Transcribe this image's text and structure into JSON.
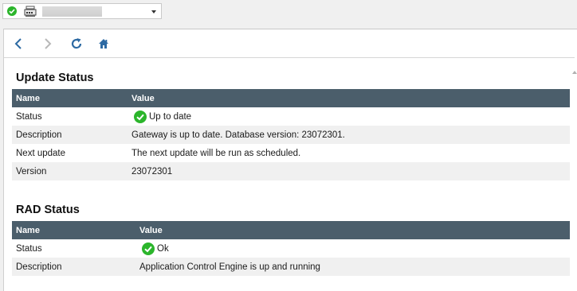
{
  "colors": {
    "header_bg": "#4b5e6b",
    "ok_green": "#2bb52b",
    "nav_blue": "#2d6aa3",
    "row_alt": "#f0f0f0"
  },
  "gateway_selector": {
    "status_icon": "check-circle-icon",
    "device_icon": "gateway-device-icon",
    "name": "",
    "dropdown_icon": "caret-down-icon"
  },
  "nav": {
    "back_icon": "chevron-left-icon",
    "forward_icon": "chevron-right-icon",
    "refresh_icon": "refresh-icon",
    "home_icon": "home-icon"
  },
  "update_status": {
    "title": "Update Status",
    "columns": [
      "Name",
      "Value"
    ],
    "rows": [
      {
        "name": "Status",
        "value": "Up to date",
        "icon": "check-circle-icon"
      },
      {
        "name": "Description",
        "value": "Gateway is up to date. Database version: 23072301."
      },
      {
        "name": "Next update",
        "value": "The next update will be run as scheduled."
      },
      {
        "name": "Version",
        "value": "23072301"
      }
    ]
  },
  "rad_status": {
    "title": "RAD Status",
    "columns": [
      "Name",
      "Value"
    ],
    "rows": [
      {
        "name": "Status",
        "value": "Ok",
        "icon": "check-circle-icon"
      },
      {
        "name": "Description",
        "value": "Application Control Engine is up and running"
      }
    ]
  }
}
